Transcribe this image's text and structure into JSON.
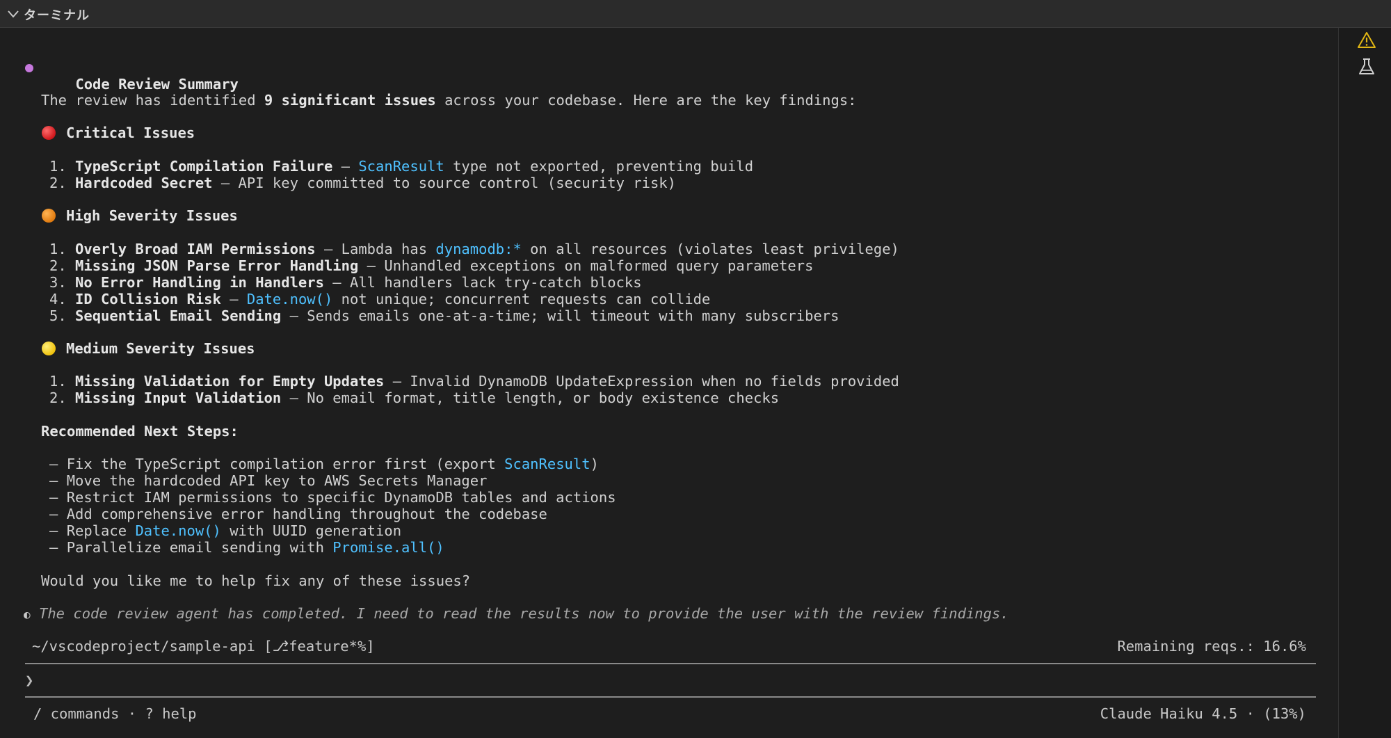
{
  "panel": {
    "title": "ターミナル"
  },
  "side_icons": [
    "warning-icon",
    "flask-icon"
  ],
  "colors": {
    "background": "#1e1e1e",
    "code_accent": "#4fc1ff",
    "summary_dot": "#c678dd",
    "critical": "#e0292e",
    "high": "#f28c1f",
    "medium": "#f5cf17",
    "warning_icon": "#e2b714"
  },
  "summary": {
    "title": "Code Review Summary",
    "intro_pre": "The review has identified ",
    "intro_bold": "9 significant issues",
    "intro_post": " across your codebase. Here are the key findings:"
  },
  "critical": {
    "title": "Critical Issues",
    "items": [
      {
        "num": "1.",
        "title": "TypeScript Compilation Failure",
        "sep": " – ",
        "code": "ScanResult",
        "rest": " type not exported, preventing build"
      },
      {
        "num": "2.",
        "title": "Hardcoded Secret",
        "sep": " – ",
        "rest": "API key committed to source control (security risk)"
      }
    ]
  },
  "high": {
    "title": "High Severity Issues",
    "items": [
      {
        "num": "1.",
        "title": "Overly Broad IAM Permissions",
        "sep": " – ",
        "pre": "Lambda has ",
        "code": "dynamodb:*",
        "rest": " on all resources (violates least privilege)"
      },
      {
        "num": "2.",
        "title": "Missing JSON Parse Error Handling",
        "sep": " – ",
        "rest": "Unhandled exceptions on malformed query parameters"
      },
      {
        "num": "3.",
        "title": "No Error Handling in Handlers",
        "sep": " – ",
        "rest": "All handlers lack try-catch blocks"
      },
      {
        "num": "4.",
        "title": "ID Collision Risk",
        "sep": " – ",
        "code": "Date.now()",
        "rest": " not unique; concurrent requests can collide"
      },
      {
        "num": "5.",
        "title": "Sequential Email Sending",
        "sep": " – ",
        "rest": "Sends emails one-at-a-time; will timeout with many subscribers"
      }
    ]
  },
  "medium": {
    "title": "Medium Severity Issues",
    "items": [
      {
        "num": "1.",
        "title": "Missing Validation for Empty Updates",
        "sep": " – ",
        "rest": "Invalid DynamoDB UpdateExpression when no fields provided"
      },
      {
        "num": "2.",
        "title": "Missing Input Validation",
        "sep": " – ",
        "rest": "No email format, title length, or body existence checks"
      }
    ]
  },
  "next_steps": {
    "title": "Recommended Next Steps:",
    "items": [
      {
        "bullet": "–",
        "pre": "Fix the TypeScript compilation error first (export ",
        "code": "ScanResult",
        "post": ")"
      },
      {
        "bullet": "–",
        "pre": "Move the hardcoded API key to AWS Secrets Manager"
      },
      {
        "bullet": "–",
        "pre": "Restrict IAM permissions to specific DynamoDB tables and actions"
      },
      {
        "bullet": "–",
        "pre": "Add comprehensive error handling throughout the codebase"
      },
      {
        "bullet": "–",
        "pre": "Replace ",
        "code": "Date.now()",
        "post": " with UUID generation"
      },
      {
        "bullet": "–",
        "pre": "Parallelize email sending with ",
        "code": "Promise.all()"
      }
    ]
  },
  "question": "Would you like me to help fix any of these issues?",
  "thinking": {
    "icon": "◐",
    "text": "The code review agent has completed. I need to read the results now to provide the user with the review findings."
  },
  "status": {
    "path": "~/vscodeproject/sample-api",
    "branch_open": " [",
    "branch_icon": "⎇",
    "branch": "feature*%",
    "branch_close": "]",
    "remaining": "Remaining reqs.: 16.6%"
  },
  "prompt": {
    "symbol": "❯",
    "value": ""
  },
  "footer": {
    "hint": "/ commands · ? help",
    "model": "Claude Haiku 4.5 · (13%)"
  }
}
